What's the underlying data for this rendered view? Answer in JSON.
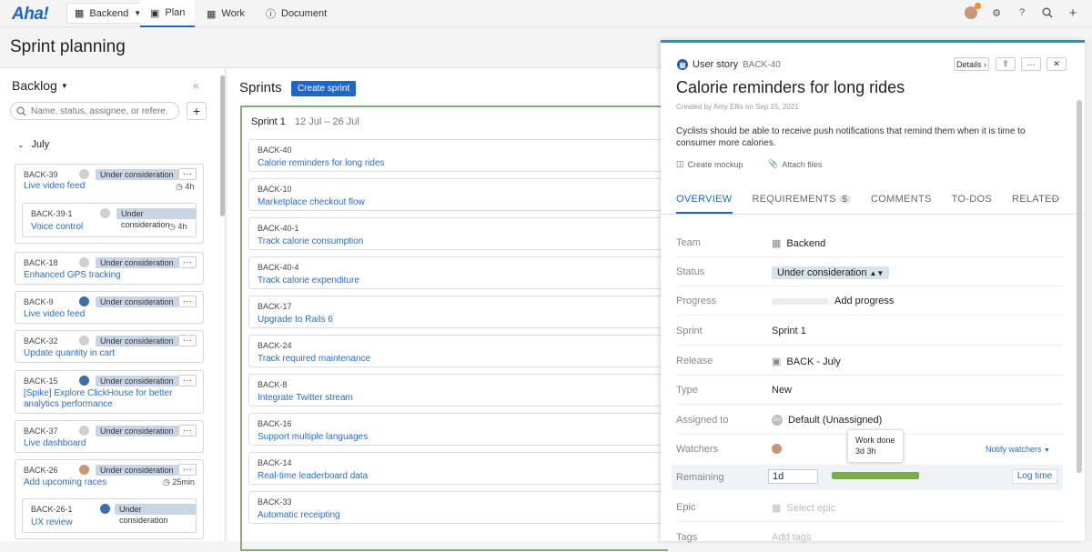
{
  "topbar": {
    "logo": "Aha!",
    "workspace": "Backend",
    "tabs": [
      {
        "label": "Plan"
      },
      {
        "label": "Work"
      },
      {
        "label": "Document"
      }
    ]
  },
  "page": {
    "title": "Sprint planning"
  },
  "backlog": {
    "title": "Backlog",
    "search_placeholder": "Name, status, assignee, or refere...",
    "group": "July",
    "cards": [
      {
        "id": "BACK-39",
        "title": "Live video feed",
        "status": "Under consideration",
        "estimate": "4h",
        "subs": [
          {
            "id": "BACK-39-1",
            "title": "Voice control",
            "status": "Under consideration",
            "estimate": "4h"
          }
        ]
      },
      {
        "id": "BACK-18",
        "title": "Enhanced GPS tracking",
        "status": "Under consideration"
      },
      {
        "id": "BACK-9",
        "title": "Live video feed",
        "status": "Under consideration"
      },
      {
        "id": "BACK-32",
        "title": "Update quantity in cart",
        "status": "Under consideration"
      },
      {
        "id": "BACK-15",
        "title": "[Spike] Explore ClickHouse for better analytics performance",
        "status": "Under consideration"
      },
      {
        "id": "BACK-37",
        "title": "Live dashboard",
        "status": "Under consideration"
      },
      {
        "id": "BACK-26",
        "title": "Add upcoming races",
        "status": "Under consideration",
        "estimate": "25min",
        "subs": [
          {
            "id": "BACK-26-1",
            "title": "UX review",
            "status": "Under consideration"
          }
        ]
      }
    ]
  },
  "sprints": {
    "title": "Sprints",
    "create_button": "Create sprint",
    "sprint": {
      "name": "Sprint 1",
      "dates": "12 Jul – 26 Jul"
    },
    "rows": [
      {
        "id": "BACK-40",
        "title": "Calorie reminders for long rides"
      },
      {
        "id": "BACK-10",
        "title": "Marketplace checkout flow"
      },
      {
        "id": "BACK-40-1",
        "title": "Track calorie consumption"
      },
      {
        "id": "BACK-40-4",
        "title": "Track calorie expenditure"
      },
      {
        "id": "BACK-17",
        "title": "Upgrade to Rails 6"
      },
      {
        "id": "BACK-24",
        "title": "Track required maintenance"
      },
      {
        "id": "BACK-8",
        "title": "Integrate Twitter stream"
      },
      {
        "id": "BACK-16",
        "title": "Support multiple languages"
      },
      {
        "id": "BACK-14",
        "title": "Real-time leaderboard data"
      },
      {
        "id": "BACK-33",
        "title": "Automatic receipting"
      }
    ]
  },
  "detail": {
    "kind": "User story",
    "id": "BACK-40",
    "details_button": "Details",
    "title": "Calorie reminders for long rides",
    "created": "Created by Amy Ellis on Sep 15, 2021",
    "description": "Cyclists should be able to receive push notifications that remind them when it is time to consumer more calories.",
    "create_mockup": "Create mockup",
    "attach_files": "Attach files",
    "tabs": {
      "overview": "OVERVIEW",
      "requirements": "REQUIREMENTS",
      "requirements_count": "5",
      "comments": "COMMENTS",
      "todos": "TO-DOS",
      "related": "RELATED"
    },
    "fields": {
      "team_label": "Team",
      "team": "Backend",
      "status_label": "Status",
      "status": "Under consideration",
      "progress_label": "Progress",
      "progress": "Add progress",
      "sprint_label": "Sprint",
      "sprint": "Sprint 1",
      "release_label": "Release",
      "release": "BACK - July",
      "type_label": "Type",
      "type": "New",
      "assigned_label": "Assigned to",
      "assigned": "Default (Unassigned)",
      "assigned_initials": "DU",
      "watchers_label": "Watchers",
      "notify": "Notify watchers",
      "remaining_label": "Remaining",
      "remaining": "1d",
      "log_time": "Log time",
      "work_done_label": "Work done",
      "work_done": "3d 3h",
      "work_done_fraction": 0.78,
      "epic_label": "Epic",
      "epic_placeholder": "Select epic",
      "tags_label": "Tags",
      "tags_placeholder": "Add tags"
    }
  }
}
